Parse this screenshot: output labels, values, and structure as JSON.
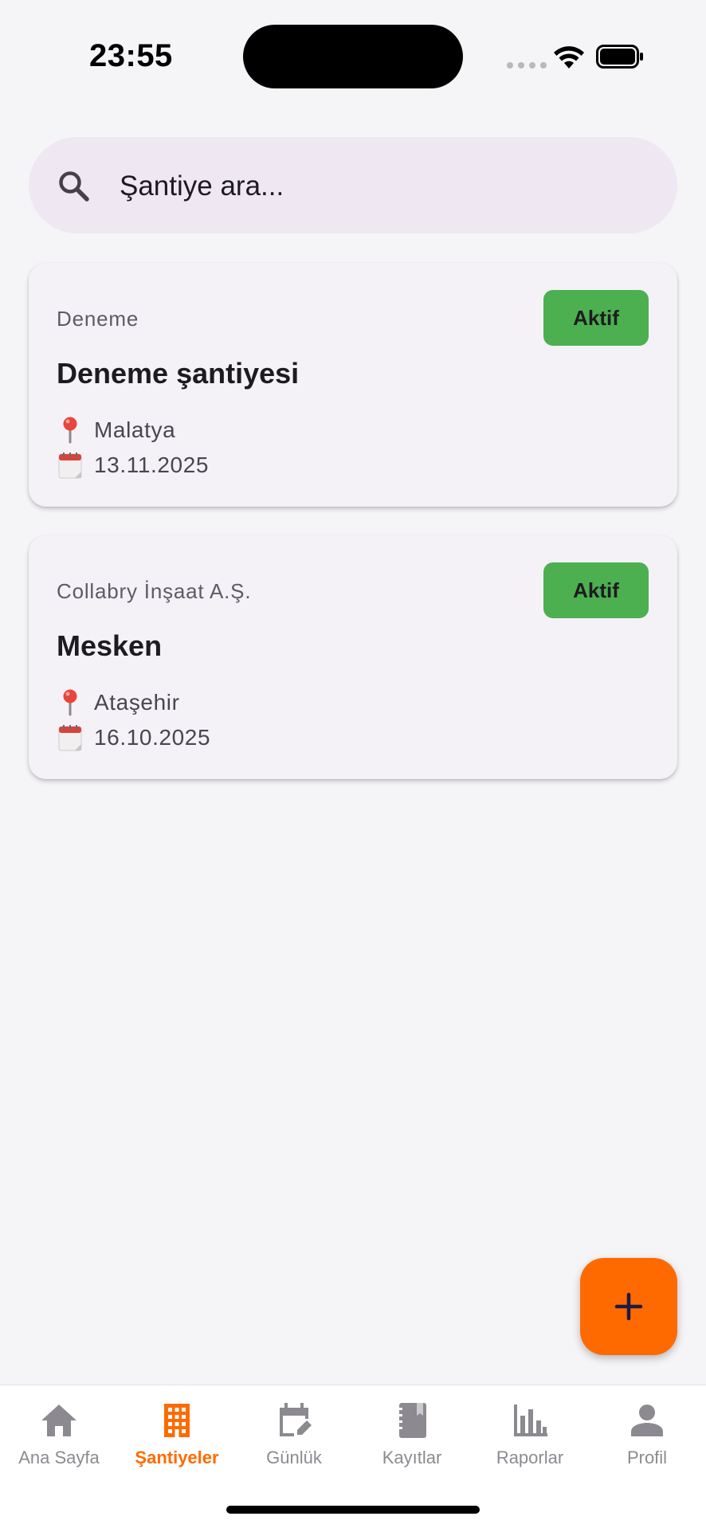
{
  "status_bar": {
    "time": "23:55"
  },
  "search": {
    "placeholder": "Şantiye ara..."
  },
  "projects": [
    {
      "company": "Deneme",
      "name": "Deneme şantiyesi",
      "status": "Aktif",
      "location": "Malatya",
      "date": "13.11.2025"
    },
    {
      "company": "Collabry İnşaat A.Ş.",
      "name": "Mesken",
      "status": "Aktif",
      "location": "Ataşehir",
      "date": "16.10.2025"
    }
  ],
  "fab": {
    "icon": "plus-icon"
  },
  "bottom_nav": {
    "items": [
      {
        "label": "Ana Sayfa",
        "icon": "home-icon"
      },
      {
        "label": "Şantiyeler",
        "icon": "building-icon",
        "active": true
      },
      {
        "label": "Günlük",
        "icon": "calendar-edit-icon"
      },
      {
        "label": "Kayıtlar",
        "icon": "notebook-icon"
      },
      {
        "label": "Raporlar",
        "icon": "bar-chart-icon"
      },
      {
        "label": "Profil",
        "icon": "person-icon"
      }
    ]
  },
  "colors": {
    "accent": "#ff6a00",
    "status_active": "#4caf50",
    "search_bg": "#efe8f2",
    "card_bg": "#f4f1f7",
    "inactive_nav": "#8c8a90"
  }
}
